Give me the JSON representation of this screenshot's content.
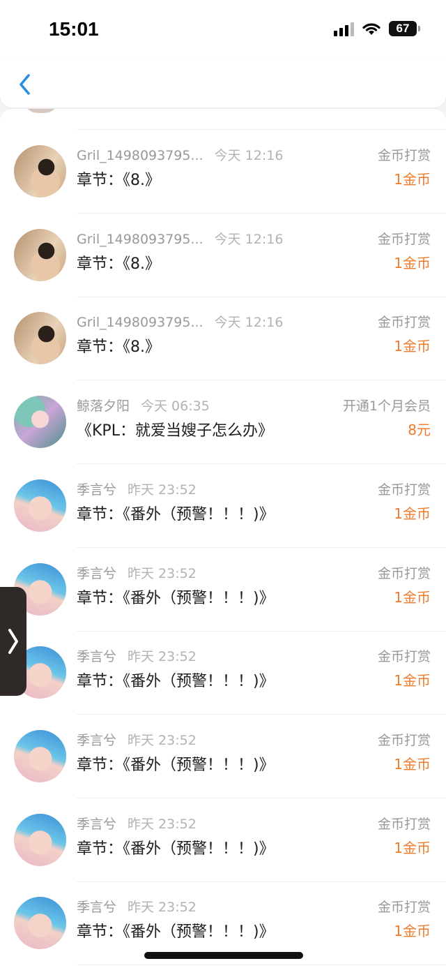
{
  "status_bar": {
    "time": "15:01",
    "battery": "67"
  },
  "nav": {
    "back_icon": "chevron-left-icon",
    "accent": "#2b8fe0"
  },
  "rows": [
    {
      "avatar": "girl",
      "name": "Gril_1498093795...",
      "time": "今天 12:16",
      "content": "章节：《8.》",
      "type": "金币打赏",
      "amount": "1金币"
    },
    {
      "avatar": "girl",
      "name": "Gril_1498093795...",
      "time": "今天 12:16",
      "content": "章节：《8.》",
      "type": "金币打赏",
      "amount": "1金币"
    },
    {
      "avatar": "girl",
      "name": "Gril_1498093795...",
      "time": "今天 12:16",
      "content": "章节：《8.》",
      "type": "金币打赏",
      "amount": "1金币"
    },
    {
      "avatar": "anime",
      "name": "鲸落夕阳",
      "time": "今天 06:35",
      "content": "《KPL：就爱当嫂子怎么办》",
      "type": "开通1个月会员",
      "amount": "8元"
    },
    {
      "avatar": "cat",
      "name": "季言兮",
      "time": "昨天 23:52",
      "content": "章节：《番外（预警！！！)》",
      "type": "金币打赏",
      "amount": "1金币"
    },
    {
      "avatar": "cat",
      "name": "季言兮",
      "time": "昨天 23:52",
      "content": "章节：《番外（预警！！！)》",
      "type": "金币打赏",
      "amount": "1金币"
    },
    {
      "avatar": "cat",
      "name": "季言兮",
      "time": "昨天 23:52",
      "content": "章节：《番外（预警！！！)》",
      "type": "金币打赏",
      "amount": "1金币"
    },
    {
      "avatar": "cat",
      "name": "季言兮",
      "time": "昨天 23:52",
      "content": "章节：《番外（预警！！！)》",
      "type": "金币打赏",
      "amount": "1金币"
    },
    {
      "avatar": "cat",
      "name": "季言兮",
      "time": "昨天 23:52",
      "content": "章节：《番外（预警！！！)》",
      "type": "金币打赏",
      "amount": "1金币"
    },
    {
      "avatar": "cat",
      "name": "季言兮",
      "time": "昨天 23:52",
      "content": "章节：《番外（预警！！！)》",
      "type": "金币打赏",
      "amount": "1金币"
    }
  ],
  "colors": {
    "amount": "#f07a2a",
    "secondary_text": "#999999",
    "primary_text": "#1e1e1e"
  }
}
